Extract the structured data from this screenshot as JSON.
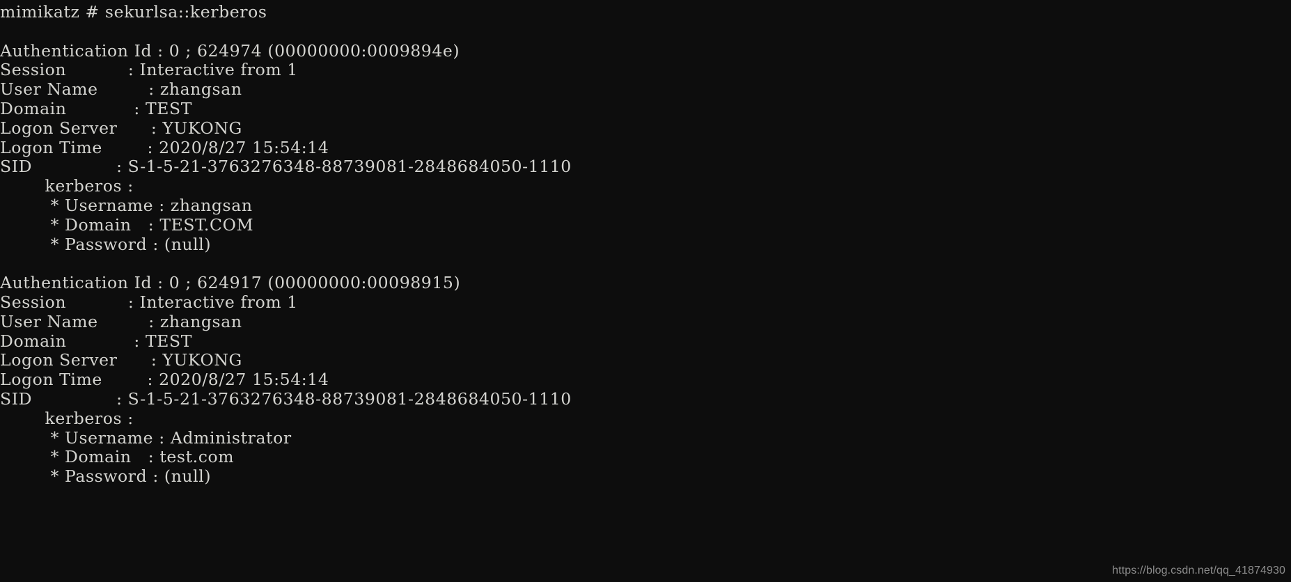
{
  "window": {
    "app_name": "mimikatz",
    "background_color": "#0d0d0d",
    "foreground_color": "#d4d4d0",
    "watermark_color": "#8c8c8c"
  },
  "prompt": {
    "text": "mimikatz # sekurlsa::kerberos",
    "program": "mimikatz",
    "separator": "#",
    "command": "sekurlsa::kerberos"
  },
  "watermark": {
    "text": "https://blog.csdn.net/qq_41874930"
  },
  "labels": {
    "auth_id": "Authentication Id",
    "session": "Session",
    "user_name": "User Name",
    "domain": "Domain",
    "logon_server": "Logon Server",
    "logon_time": "Logon Time",
    "sid": "SID",
    "provider": "kerberos",
    "k_username": "Username",
    "k_domain": "Domain",
    "k_password": "Password"
  },
  "sessions": [
    {
      "auth_id": "0 ; 624974 (00000000:0009894e)",
      "session": "Interactive from 1",
      "user_name": "zhangsan",
      "domain": "TEST",
      "logon_server": "YUKONG",
      "logon_time": "2020/8/27 15:54:14",
      "sid": "S-1-5-21-3763276348-88739081-2848684050-1110",
      "kerberos": {
        "username": "zhangsan",
        "domain": "TEST.COM",
        "password": "(null)"
      }
    },
    {
      "auth_id": "0 ; 624917 (00000000:00098915)",
      "session": "Interactive from 1",
      "user_name": "zhangsan",
      "domain": "TEST",
      "logon_server": "YUKONG",
      "logon_time": "2020/8/27 15:54:14",
      "sid": "S-1-5-21-3763276348-88739081-2848684050-1110",
      "kerberos": {
        "username": "Administrator",
        "domain": "test.com",
        "password": "(null)"
      }
    }
  ],
  "lines": [
    "mimikatz # sekurlsa::kerberos",
    "",
    "Authentication Id : 0 ; 624974 (00000000:0009894e)",
    "Session           : Interactive from 1",
    "User Name         : zhangsan",
    "Domain            : TEST",
    "Logon Server      : YUKONG",
    "Logon Time        : 2020/8/27 15:54:14",
    "SID               : S-1-5-21-3763276348-88739081-2848684050-1110",
    "        kerberos :",
    "         * Username : zhangsan",
    "         * Domain   : TEST.COM",
    "         * Password : (null)",
    "",
    "Authentication Id : 0 ; 624917 (00000000:00098915)",
    "Session           : Interactive from 1",
    "User Name         : zhangsan",
    "Domain            : TEST",
    "Logon Server      : YUKONG",
    "Logon Time        : 2020/8/27 15:54:14",
    "SID               : S-1-5-21-3763276348-88739081-2848684050-1110",
    "        kerberos :",
    "         * Username : Administrator",
    "         * Domain   : test.com",
    "         * Password : (null)"
  ]
}
